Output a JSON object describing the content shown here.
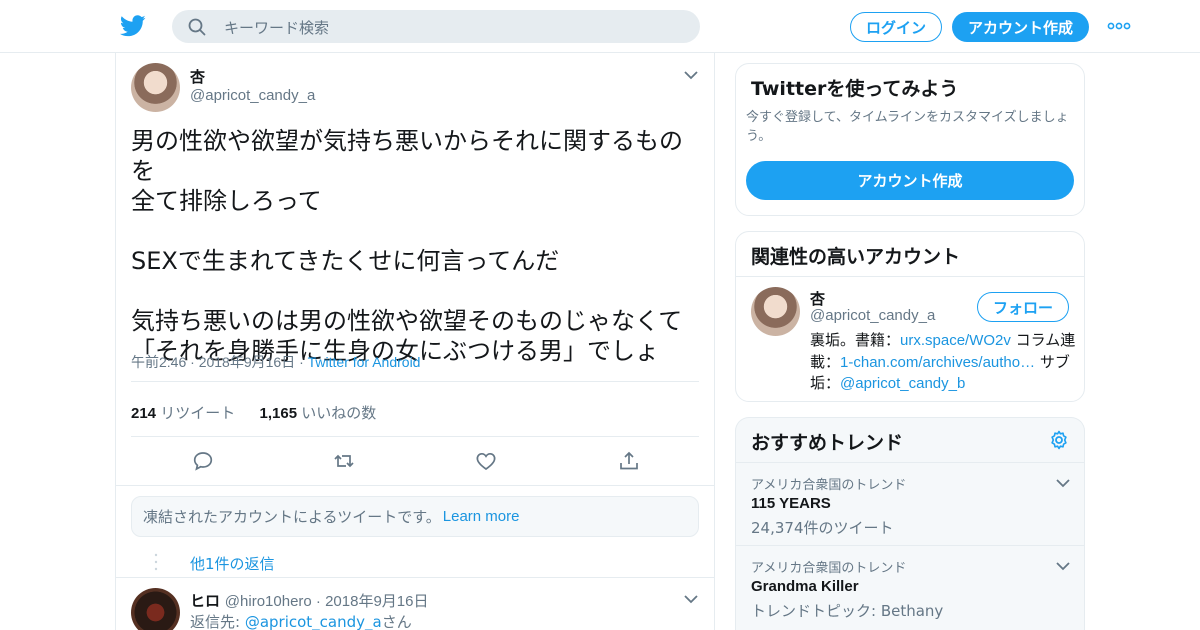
{
  "header": {
    "logo_icon": "twitter-bird-icon",
    "search_placeholder": "キーワード検索",
    "login_label": "ログイン",
    "signup_label": "アカウント作成",
    "more_icon": "more-dots-icon"
  },
  "tweet": {
    "name": "杏",
    "handle": "@apricot_candy_a",
    "text": "男の性欲や欲望が気持ち悪いからそれに関するものを\n全て排除しろって\n\nSEXで生まれてきたくせに何言ってんだ\n\n気持ち悪いのは男の性欲や欲望そのものじゃなくて\n「それを身勝手に生身の女にぶつける男」でしょ",
    "time": "午前2:46 · 2018年9月16日 · ",
    "source": "Twitter for Android",
    "retweets": "214",
    "retweets_label": " リツイート",
    "likes": "1,165",
    "likes_label": " いいねの数"
  },
  "notice": {
    "text": "凍結されたアカウントによるツイートです。",
    "link": "Learn more"
  },
  "replies": {
    "more_label": "他1件の返信",
    "reply": {
      "name": "ヒロ",
      "handle_date": "@hiro10hero · 2018年9月16日",
      "reply_prefix": "返信先: ",
      "reply_to": "@apricot_candy_a",
      "reply_suffix": "さん"
    }
  },
  "sidebar": {
    "promo": {
      "title": "Twitterを使ってみよう",
      "subtitle": "今すぐ登録して、タイムラインをカスタマイズしましょう。",
      "button": "アカウント作成"
    },
    "related": {
      "title": "関連性の高いアカウント",
      "name": "杏",
      "handle": "@apricot_candy_a",
      "follow": "フォロー",
      "bio_1": "裏垢。書籍：",
      "bio_link_1": "urx.space/WO2v",
      "bio_2": " コラム連載：",
      "bio_link_2": "1-chan.com/archives/autho…",
      "bio_3": " サブ垢：",
      "bio_link_3": "@apricot_candy_b"
    },
    "trends": {
      "title": "おすすめトレンド",
      "items": [
        {
          "context": "アメリカ合衆国のトレンド",
          "name": "115 YEARS",
          "meta": "24,374件のツイート"
        },
        {
          "context": "アメリカ合衆国のトレンド",
          "name": "Grandma Killer",
          "meta": "トレンドトピック: Bethany"
        }
      ]
    }
  },
  "colors": {
    "accent": "#1da1f2",
    "link": "#1b95e0",
    "muted": "#657786",
    "border": "#e6ecf0"
  }
}
